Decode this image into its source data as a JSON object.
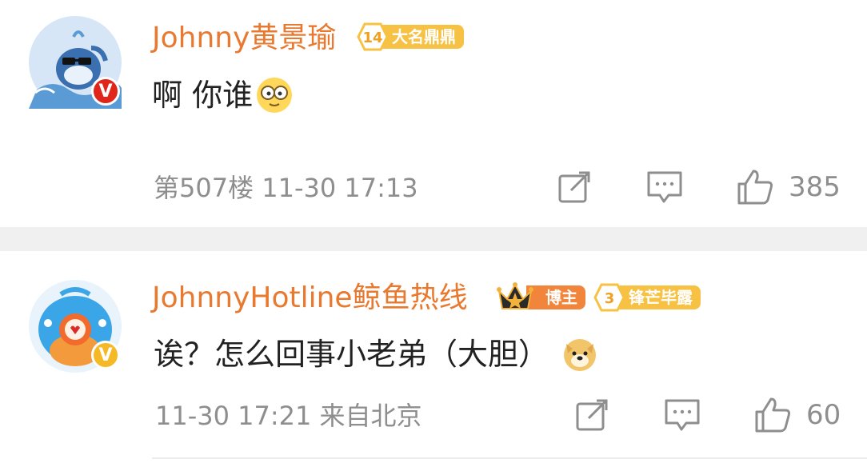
{
  "comments": [
    {
      "username": "Johnny黄景瑜",
      "level": "14",
      "badge_text": "大名鼎鼎",
      "content": "啊 你谁",
      "content_emoji": "glasses-face-emoji",
      "floor_time": "第507楼 11-30 17:13",
      "like_count": "385",
      "verified_icon": "V",
      "accent_color": "#e8792f"
    },
    {
      "username": "JohnnyHotline鲸鱼热线",
      "role_badge": "博主",
      "level": "3",
      "badge_text": "锋芒毕露",
      "content": "诶？怎么回事小老弟（大胆）",
      "content_emoji": "doge-emoji",
      "time_location": "11-30 17:21 来自北京",
      "like_count": "60",
      "verified_icon": "V",
      "accent_color": "#e8792f"
    }
  ]
}
